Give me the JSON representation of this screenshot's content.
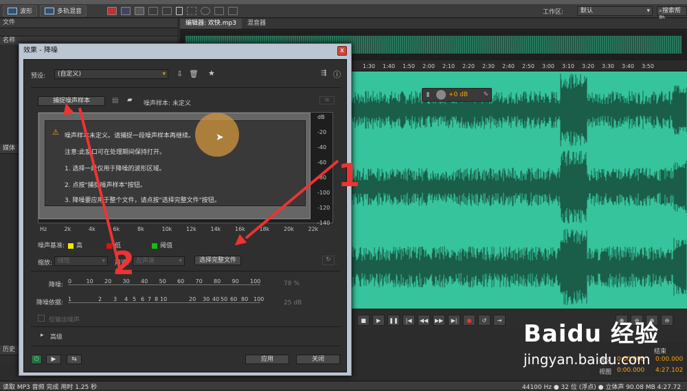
{
  "toolbar": {
    "waveform_label": "波形",
    "multitrack_label": "多轨混音",
    "workspace_label": "工作区:",
    "workspace_value": "默认",
    "search_label": "搜索帮助"
  },
  "left_panel": {
    "files_tab": "文件",
    "name_col": "名称",
    "media_tab": "媒体",
    "history_tab": "历史"
  },
  "editor": {
    "tab_editor": "编辑器: 欢快.mp3",
    "tab_mixer": "混音器",
    "ruler_ticks": [
      "1:30",
      "1:40",
      "1:50",
      "2:00",
      "2:10",
      "2:20",
      "2:30",
      "2:40",
      "2:50",
      "3:00",
      "3:10",
      "3:20",
      "3:30",
      "3:40",
      "3:50"
    ],
    "hud_gain": "+0 dB"
  },
  "selection": {
    "end_label": "结束",
    "row1_label": "选区",
    "row1_start": "0:00.000",
    "row1_end": "0:00.000",
    "row2_label": "视图",
    "row2_start": "0:00.000",
    "row2_end": "4:27.102"
  },
  "status": {
    "left": "读取 MP3 音频 完成 用时 1.25 秒",
    "right": "44100 Hz ● 32 位 (浮点) ● 立体声   90.08 MB   4:27.72"
  },
  "dialog": {
    "title": "效果 - 降噪",
    "close_label": "x",
    "preset_label": "预设:",
    "preset_value": "(自定义)",
    "capture_button": "捕捉噪声样本",
    "noise_sample_label": "噪声样本: 未定义",
    "messages": [
      "噪声样本未定义。请捕捉一段噪声样本再继续。",
      "注意:此窗口可在处理期间保持打开。",
      "1. 选择一段仅用于降噪的波形区域。",
      "2. 点按\"捕捉噪声样本\"按钮。",
      "3. 降噪要应用于整个文件，请点按\"选择完整文件\"按钮。"
    ],
    "db_labels": [
      "dB",
      "-20",
      "-40",
      "-60",
      "-80",
      "-100",
      "-120",
      "-140"
    ],
    "hz_labels": [
      "Hz",
      "2k",
      "4k",
      "6k",
      "8k",
      "10k",
      "12k",
      "14k",
      "16k",
      "18k",
      "20k",
      "22k"
    ],
    "legend_label": "噪声基准:",
    "legend_items": [
      {
        "label": "高",
        "color": "#f2e600"
      },
      {
        "label": "低",
        "color": "#e01010"
      },
      {
        "label": "阈值",
        "color": "#10c010"
      }
    ],
    "scale_label": "缩放:",
    "scale_value": "线性",
    "channel_label": "声道:",
    "channel_value": "左声道",
    "select_file_button": "选择完整文件",
    "reduce_label": "降噪:",
    "reduce_ticks": [
      "0",
      "10",
      "20",
      "30",
      "40",
      "50",
      "60",
      "70",
      "80",
      "90",
      "100"
    ],
    "reduce_value": "78 %",
    "reduce_by_label": "降噪依据:",
    "reduce_by_ticks": [
      "1",
      "2",
      "3",
      "4",
      "5",
      "6",
      "7",
      "8",
      "10",
      "20",
      "30",
      "40",
      "50",
      "60",
      "80",
      "100"
    ],
    "reduce_by_value": "25 dB",
    "output_noise_label": "仅输出噪声",
    "advanced_label": "高级",
    "apply_button": "应用",
    "close_button": "关闭"
  },
  "annotations": {
    "number_1": "1",
    "number_2": "2"
  },
  "watermark": {
    "brand": "Baidu 经验",
    "url": "jingyan.baidu.com"
  }
}
